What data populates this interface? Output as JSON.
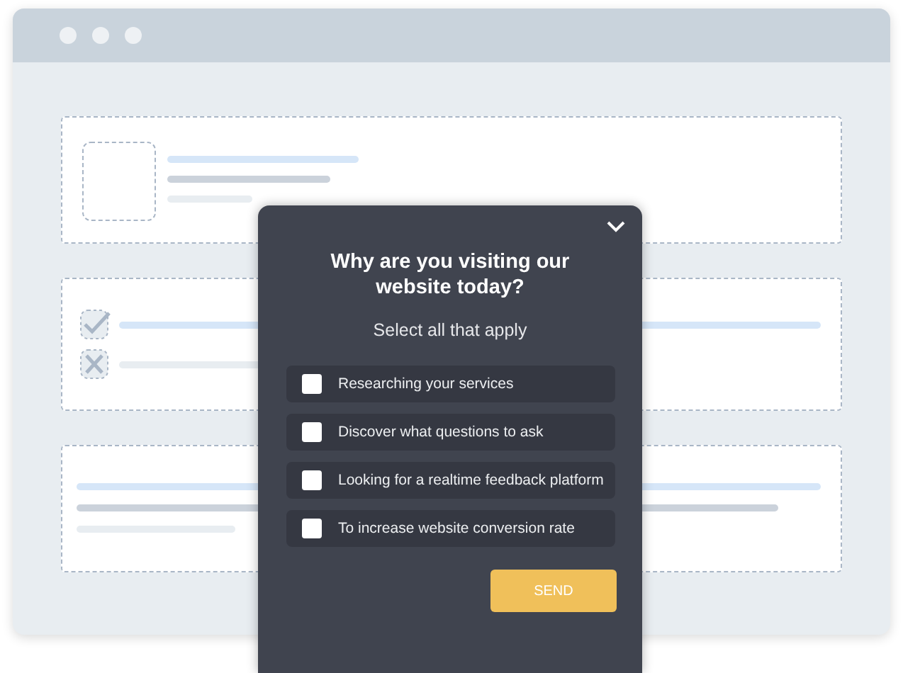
{
  "survey": {
    "title": "Why are you visiting our website today?",
    "subtitle": "Select all that apply",
    "options": [
      {
        "label": "Researching your services",
        "checked": false
      },
      {
        "label": "Discover what questions to ask",
        "checked": false
      },
      {
        "label": "Looking for a realtime feedback platform",
        "checked": false
      },
      {
        "label": "To increase website conversion rate",
        "checked": false
      }
    ],
    "send_button": "SEND"
  }
}
